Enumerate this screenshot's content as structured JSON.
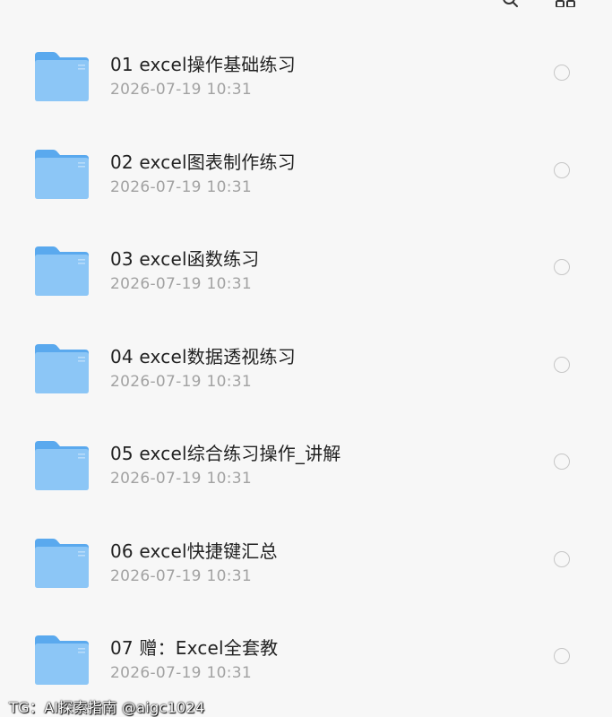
{
  "header": {
    "title": "",
    "icons": [
      "search-icon",
      "grid-icon"
    ]
  },
  "colors": {
    "folder_back": "#5aa9ee",
    "folder_front": "#8cc6f6",
    "check_border": "#c6c6c6",
    "name_text": "#222222",
    "time_text": "#a2a2a2"
  },
  "files": [
    {
      "name": "01 excel操作基础练习",
      "time": "2026-07-19 10:31",
      "icon": "folder-icon",
      "selected": false
    },
    {
      "name": "02 excel图表制作练习",
      "time": "2026-07-19 10:31",
      "icon": "folder-icon",
      "selected": false
    },
    {
      "name": "03 excel函数练习",
      "time": "2026-07-19 10:31",
      "icon": "folder-icon",
      "selected": false
    },
    {
      "name": "04 excel数据透视练习",
      "time": "2026-07-19 10:31",
      "icon": "folder-icon",
      "selected": false
    },
    {
      "name": "05 excel综合练习操作_讲解",
      "time": "2026-07-19 10:31",
      "icon": "folder-icon",
      "selected": false
    },
    {
      "name": "06 excel快捷键汇总",
      "time": "2026-07-19 10:31",
      "icon": "folder-icon",
      "selected": false
    },
    {
      "name": "07 赠：Excel全套教",
      "time": "2026-07-19 10:31",
      "icon": "folder-icon",
      "selected": false
    }
  ],
  "watermark": "TG：AI探索指南 @aigc1024"
}
